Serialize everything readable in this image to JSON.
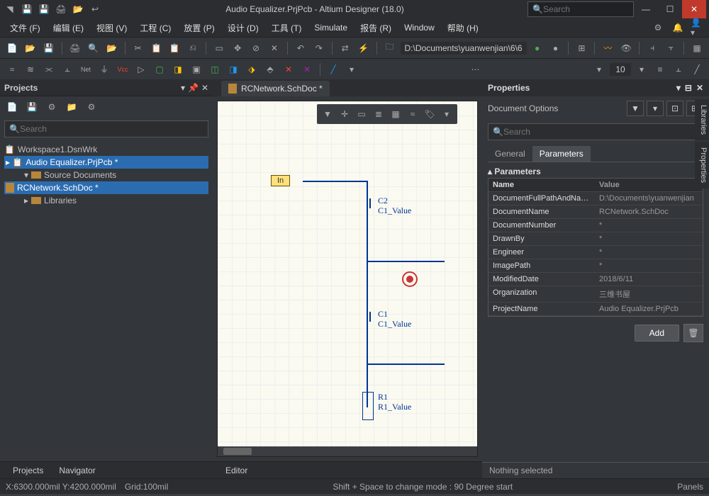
{
  "title": "Audio Equalizer.PrjPcb - Altium Designer (18.0)",
  "global_search_placeholder": "Search",
  "menubar": {
    "items": [
      "文件 (F)",
      "编辑 (E)",
      "视图 (V)",
      "工程 (C)",
      "放置 (P)",
      "设计 (D)",
      "工具 (T)",
      "Simulate",
      "报告 (R)",
      "Window",
      "帮助 (H)"
    ]
  },
  "path_display": "D:\\Documents\\yuanwenjian\\6\\6",
  "page_number": "10",
  "projects": {
    "title": "Projects",
    "search_placeholder": "Search",
    "workspace": "Workspace1.DsnWrk",
    "project": "Audio Equalizer.PrjPcb *",
    "source_folder": "Source Documents",
    "doc": "RCNetwork.SchDoc *",
    "libraries": "Libraries",
    "bottom_tabs": [
      "Projects",
      "Navigator"
    ]
  },
  "editor": {
    "tab": "RCNetwork.SchDoc *",
    "port_label": "In",
    "c2": {
      "designator": "C2",
      "value": "C1_Value"
    },
    "c1": {
      "designator": "C1",
      "value": "C1_Value"
    },
    "r1": {
      "designator": "R1",
      "value": "R1_Value"
    },
    "bottom_tab": "Editor"
  },
  "properties": {
    "title": "Properties",
    "doc_options": "Document Options",
    "search_placeholder": "Search",
    "tabs": [
      "General",
      "Parameters"
    ],
    "active_tab": 1,
    "section": "Parameters",
    "columns": [
      "Name",
      "Value"
    ],
    "rows": [
      {
        "name": "DocumentFullPathAndName",
        "value": "D:\\Documents\\yuanwenjian"
      },
      {
        "name": "DocumentName",
        "value": "RCNetwork.SchDoc"
      },
      {
        "name": "DocumentNumber",
        "value": "*"
      },
      {
        "name": "DrawnBy",
        "value": "*"
      },
      {
        "name": "Engineer",
        "value": "*"
      },
      {
        "name": "ImagePath",
        "value": "*"
      },
      {
        "name": "ModifiedDate",
        "value": "2018/6/11"
      },
      {
        "name": "Organization",
        "value": "三维书屋"
      },
      {
        "name": "ProjectName",
        "value": "Audio Equalizer.PrjPcb"
      }
    ],
    "add_label": "Add",
    "nothing": "Nothing selected"
  },
  "side_tabs": [
    "Libraries",
    "Properties"
  ],
  "statusbar": {
    "left_coord": "X:6300.000mil Y:4200.000mil",
    "grid": "Grid:100mil",
    "center": "Shift + Space to change mode : 90 Degree start",
    "panels": "Panels"
  }
}
